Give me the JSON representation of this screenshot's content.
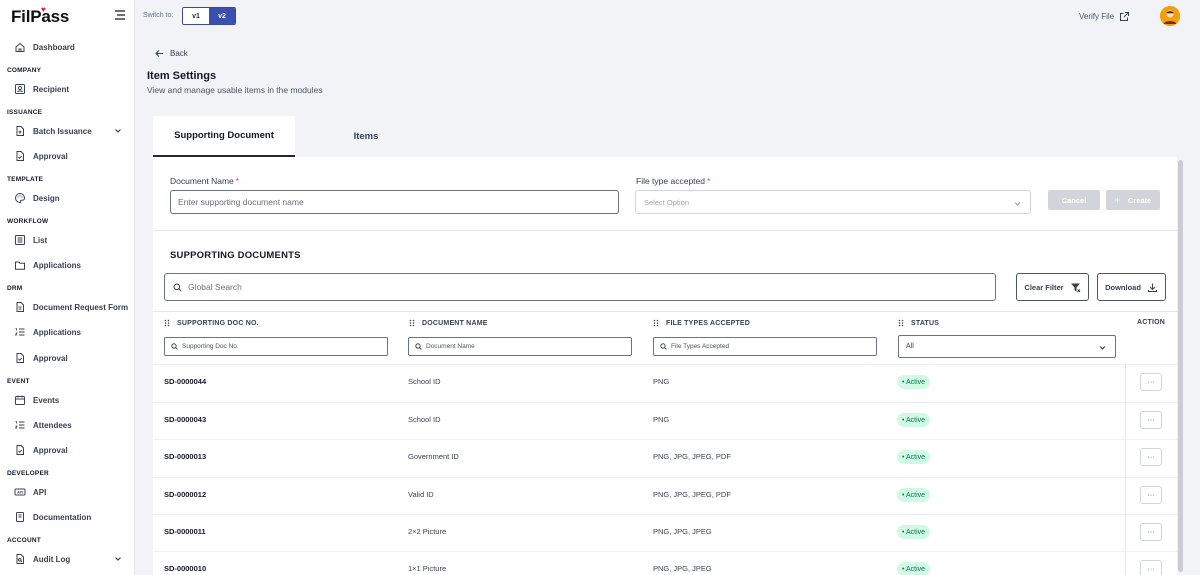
{
  "brand": {
    "logo_text": "FilPass"
  },
  "topbar": {
    "switch_label": "Switch to:",
    "versions": [
      "v1",
      "v2"
    ],
    "active_version": "v2",
    "verify_label": "Verify File"
  },
  "sidebar": {
    "dashboard": "Dashboard",
    "sections": {
      "company": "COMPANY",
      "issuance": "ISSUANCE",
      "template": "TEMPLATE",
      "workflow": "WORKFLOW",
      "drm": "DRM",
      "event": "EVENT",
      "developer": "DEVELOPER",
      "account": "ACCOUNT"
    },
    "items": {
      "recipient": "Recipient",
      "batch_issuance": "Batch Issuance",
      "issuance_approval": "Approval",
      "design": "Design",
      "list": "List",
      "workflow_applications": "Applications",
      "document_request_form": "Document Request Form",
      "drm_applications": "Applications",
      "drm_approval": "Approval",
      "events": "Events",
      "attendees": "Attendees",
      "event_approval": "Approval",
      "api": "API",
      "documentation": "Documentation",
      "audit_log": "Audit Log"
    }
  },
  "header": {
    "back": "Back",
    "title": "Item Settings",
    "subtitle": "View and manage usable items in the modules"
  },
  "tabs": [
    {
      "label": "Supporting Document",
      "active": true
    },
    {
      "label": "Items",
      "active": false
    }
  ],
  "form": {
    "doc_name_label": "Document Name",
    "doc_name_placeholder": "Enter supporting document name",
    "file_type_label": "File type accepted",
    "file_type_placeholder": "Select Option",
    "required_mark": "*",
    "cancel": "Cancel",
    "create": "Create"
  },
  "list": {
    "title": "SUPPORTING DOCUMENTS",
    "search_placeholder": "Global Search",
    "clear_filter": "Clear Filter",
    "download": "Download",
    "columns": {
      "doc_no": "SUPPORTING DOC NO.",
      "doc_name": "DOCUMENT NAME",
      "file_types": "FILE TYPES ACCEPTED",
      "status": "STATUS",
      "action": "ACTION"
    },
    "filters": {
      "doc_no": "Supporting Doc No.",
      "doc_name": "Document Name",
      "file_types": "File Types Accepted",
      "status": "All"
    },
    "action_label": "···",
    "rows": [
      {
        "id": "SD-0000044",
        "name": "School ID",
        "types": "PNG",
        "status": "• Active"
      },
      {
        "id": "SD-0000043",
        "name": "School ID",
        "types": "PNG",
        "status": "• Active"
      },
      {
        "id": "SD-0000013",
        "name": "Government ID",
        "types": "PNG, JPG, JPEG, PDF",
        "status": "• Active"
      },
      {
        "id": "SD-0000012",
        "name": "Valid ID",
        "types": "PNG, JPG, JPEG, PDF",
        "status": "• Active"
      },
      {
        "id": "SD-0000011",
        "name": "2×2 Picture",
        "types": "PNG, JPG, JPEG",
        "status": "• Active"
      },
      {
        "id": "SD-0000010",
        "name": "1×1 Picture",
        "types": "PNG, JPG, JPEG",
        "status": "• Active"
      }
    ]
  },
  "colors": {
    "primary": "#3b4fb0",
    "active_badge_bg": "#d1fae5",
    "active_badge_text": "#047857",
    "required": "#ef4444",
    "logo_heart": "#e11d48"
  }
}
